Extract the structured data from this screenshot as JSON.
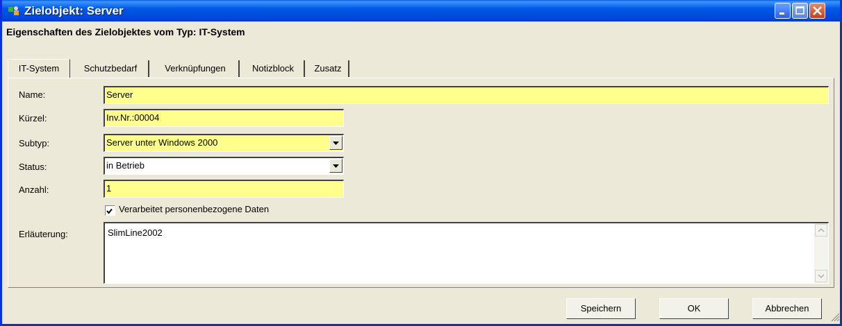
{
  "window": {
    "title": "Zielobjekt: Server"
  },
  "heading": "Eigenschaften des Zielobjektes vom Typ: IT-System",
  "tabs": [
    {
      "label": "IT-System",
      "active": true
    },
    {
      "label": "Schutzbedarf"
    },
    {
      "label": "Verknüpfungen"
    },
    {
      "label": "Notizblock"
    },
    {
      "label": "Zusatz"
    }
  ],
  "form": {
    "name_label": "Name:",
    "name_value": "Server",
    "kuerzel_label": "Kürzel:",
    "kuerzel_value": "Inv.Nr.:00004",
    "subtyp_label": "Subtyp:",
    "subtyp_value": "Server unter Windows 2000",
    "status_label": "Status:",
    "status_value": "in Betrieb",
    "anzahl_label": "Anzahl:",
    "anzahl_value": "1",
    "checkbox_label": "Verarbeitet personenbezogene Daten",
    "checkbox_checked": true,
    "erlaeuterung_label": "Erläuterung:",
    "erlaeuterung_value": "SlimLine2002"
  },
  "buttons": {
    "save": "Speichern",
    "ok": "OK",
    "cancel": "Abbrechen"
  },
  "colors": {
    "titlebar": "#0054e3",
    "required_field": "#ffff8c",
    "dialog_bg": "#ece9d8"
  }
}
